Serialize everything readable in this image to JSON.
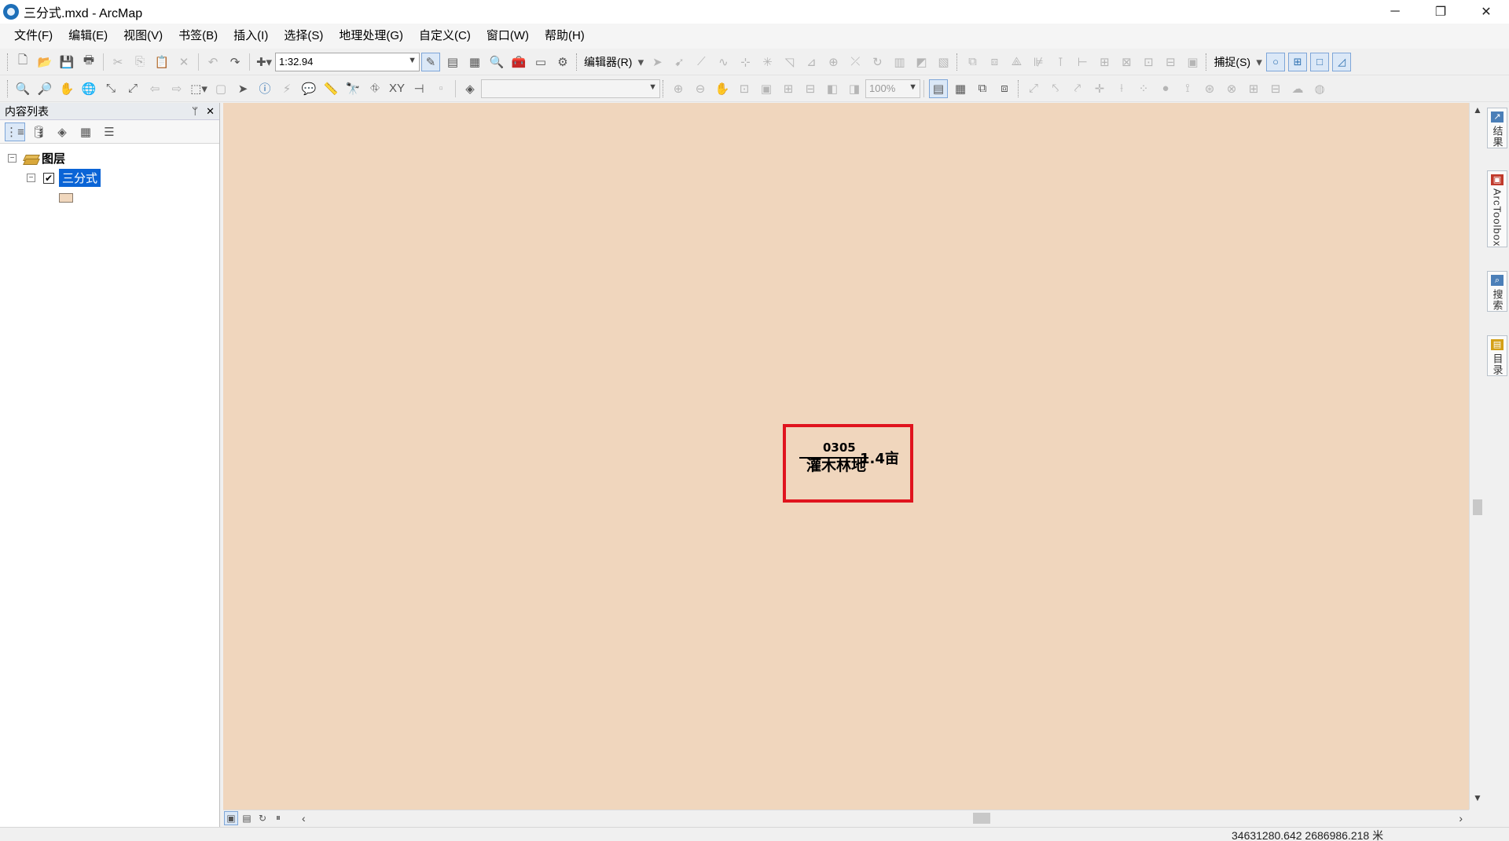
{
  "window": {
    "title": "三分式.mxd - ArcMap",
    "controls": {
      "minimize": "─",
      "restore": "❐",
      "close": "✕"
    }
  },
  "menu": [
    "文件(F)",
    "编辑(E)",
    "视图(V)",
    "书签(B)",
    "插入(I)",
    "选择(S)",
    "地理处理(G)",
    "自定义(C)",
    "窗口(W)",
    "帮助(H)"
  ],
  "toolbar": {
    "scale": "1:32.94",
    "editor_label": "编辑器(R)",
    "snapping_label": "捕捉(S)",
    "zoom_percent": "100%"
  },
  "toc": {
    "title": "内容列表",
    "pin": "ᛘ",
    "close": "✕",
    "root_label": "图层",
    "layer_label": "三分式",
    "layer_checked": true,
    "symbol_color": "#f0d7bd"
  },
  "map": {
    "background_color": "#f0d6bd",
    "highlight_color": "#e0141e",
    "label_code": "0305",
    "label_type": "灌木林地",
    "label_area": "1.4亩"
  },
  "right_dock": {
    "tabs": [
      "结果",
      "ArcToolbox",
      "搜索",
      "目录"
    ]
  },
  "status": {
    "coordinates": "34631280.642  2686986.218 米"
  }
}
